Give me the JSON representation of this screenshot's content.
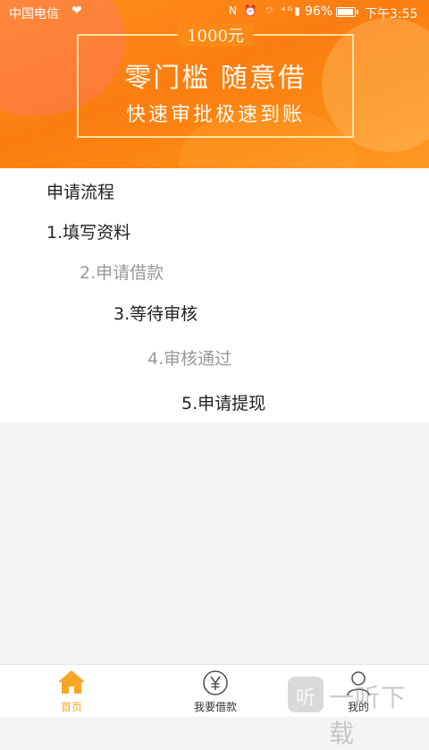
{
  "status_bar": {
    "carrier": "中国电信",
    "heart": "❤",
    "signal_icons": "N ⏰ ⌔ ⁴ᴳ▮",
    "battery_percent": "96%",
    "time": "下午3:55"
  },
  "banner": {
    "amount": "1000元",
    "headline": "零门槛 随意借",
    "subline": "快速审批极速到账"
  },
  "process": {
    "title": "申请流程",
    "steps": [
      {
        "label": "1.填写资料",
        "state": "active"
      },
      {
        "label": "2.申请借款",
        "state": "muted"
      },
      {
        "label": "3.等待审核",
        "state": "active"
      },
      {
        "label": "4.审核通过",
        "state": "muted"
      },
      {
        "label": "5.申请提现",
        "state": "active"
      }
    ]
  },
  "bottom_nav": {
    "items": [
      {
        "label": "首页",
        "icon": "home-icon",
        "selected": true
      },
      {
        "label": "我要借款",
        "icon": "yen-coin-icon",
        "selected": false
      },
      {
        "label": "我的",
        "icon": "user-icon",
        "selected": false
      }
    ]
  },
  "watermark": {
    "logo_char": "听",
    "text": "一听下载"
  },
  "colors": {
    "banner_orange": "#fb8a14",
    "nav_selected": "#f6a623",
    "muted_text": "#999999"
  }
}
